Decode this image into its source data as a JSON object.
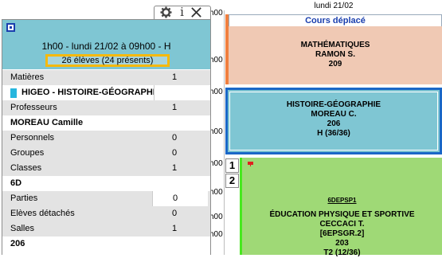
{
  "timetable": {
    "day_header": "lundi 21/02",
    "hour_labels": [
      "h00",
      "h00",
      "h00",
      "h00",
      "h00",
      "h00",
      "h00",
      "h00"
    ],
    "moved_label": "Cours déplacé",
    "courses": {
      "math": {
        "subject": "MATHÉMATIQUES",
        "teacher": "RAMON S.",
        "room": "209",
        "color": "#f0c9b4",
        "accent": "#f07f3f"
      },
      "hist": {
        "subject": "HISTOIRE-GÉOGRAPHIE",
        "teacher": "MOREAU C.",
        "room": "206",
        "group": "H (36/36)",
        "color": "#7fc6d3",
        "accent": "#1a67c7"
      },
      "eps": {
        "code": "6DEPSP1",
        "subject": "ÉDUCATION PHYSIQUE ET SPORTIVE",
        "teacher": "CECCACI T.",
        "group": "[6EPSGR.2]",
        "room": "203",
        "extra": "T2 (12/36)",
        "color": "#9fd976",
        "accent": "#47e81f"
      }
    },
    "week_numbers": [
      "1",
      "2"
    ]
  },
  "panel": {
    "toolbar": {
      "settings_icon": "gear-icon",
      "info_icon": "info-icon",
      "close_icon": "close-icon"
    },
    "header": {
      "title": "1h00  -  lundi 21/02 à 09h00  -  H",
      "students": "26 élèves (24 présents)"
    },
    "rows": [
      {
        "label": "Matières",
        "count": "1",
        "type": "cat"
      },
      {
        "label": "HIGEO - HISTOIRE-GÉOGRAPHIE",
        "type": "val",
        "swatch": "#27b6de"
      },
      {
        "label": "Professeurs",
        "count": "1",
        "type": "cat"
      },
      {
        "label": "MOREAU Camille",
        "type": "val"
      },
      {
        "label": "Personnels",
        "count": "0",
        "type": "cat"
      },
      {
        "label": "Groupes",
        "count": "0",
        "type": "cat"
      },
      {
        "label": "Classes",
        "count": "1",
        "type": "cat"
      },
      {
        "label": "6D",
        "type": "val"
      },
      {
        "label": "Parties",
        "count": "0",
        "type": "cat"
      },
      {
        "label": "Elèves détachés",
        "count": "0",
        "type": "cat"
      },
      {
        "label": "Salles",
        "count": "1",
        "type": "cat"
      },
      {
        "label": "206",
        "type": "val"
      }
    ]
  }
}
